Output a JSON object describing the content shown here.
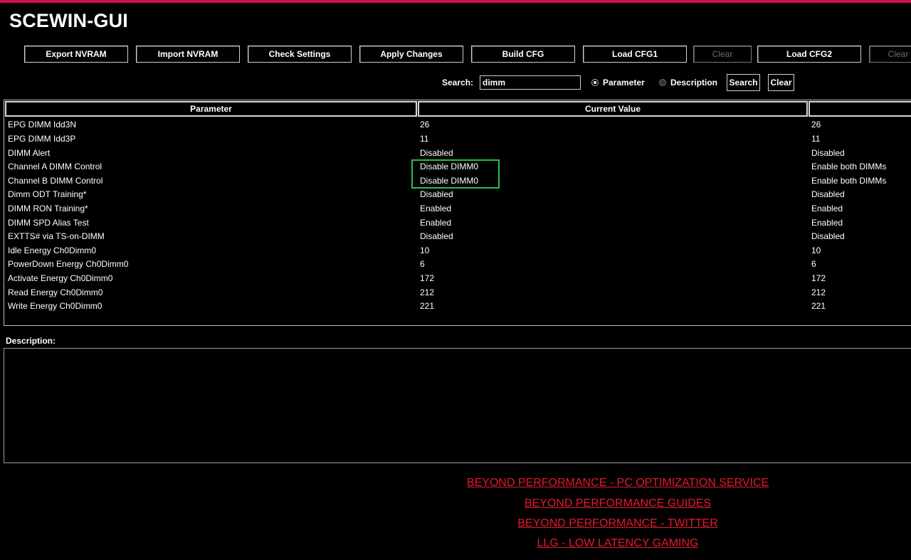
{
  "app": {
    "title": "SCEWIN-GUI"
  },
  "toolbar": {
    "export_nvram": "Export NVRAM",
    "import_nvram": "Import NVRAM",
    "check_settings": "Check Settings",
    "apply_changes": "Apply Changes",
    "build_cfg": "Build CFG",
    "load_cfg1": "Load CFG1",
    "clear1": "Clear",
    "load_cfg2": "Load CFG2",
    "clear2": "Clear"
  },
  "search": {
    "label": "Search:",
    "value": "dimm",
    "mode_parameter": "Parameter",
    "mode_description": "Description",
    "selected_mode": "Parameter",
    "search_button": "Search",
    "clear_button": "Clear"
  },
  "table": {
    "headers": [
      "Parameter",
      "Current Value",
      ""
    ],
    "rows": [
      [
        "EPG DIMM Idd3N",
        "26",
        "26"
      ],
      [
        "EPG DIMM Idd3P",
        "11",
        "11"
      ],
      [
        "DIMM Alert",
        "Disabled",
        "Disabled"
      ],
      [
        "Channel A DIMM Control",
        "Disable DIMM0",
        "Enable both DIMMs"
      ],
      [
        "Channel B DIMM Control",
        "Disable DIMM0",
        "Enable both DIMMs"
      ],
      [
        "Dimm ODT Training*",
        "Disabled",
        "Disabled"
      ],
      [
        "DIMM RON Training*",
        "Enabled",
        "Enabled"
      ],
      [
        "DIMM SPD Alias Test",
        "Enabled",
        "Enabled"
      ],
      [
        "EXTTS# via TS-on-DIMM",
        "Disabled",
        "Disabled"
      ],
      [
        "Idle Energy Ch0Dimm0",
        "10",
        "10"
      ],
      [
        "PowerDown Energy Ch0Dimm0",
        "6",
        "6"
      ],
      [
        "Activate Energy Ch0Dimm0",
        "172",
        "172"
      ],
      [
        "Read Energy Ch0Dimm0",
        "212",
        "212"
      ],
      [
        "Write Energy Ch0Dimm0",
        "221",
        "221"
      ]
    ]
  },
  "description": {
    "label": "Description:",
    "text": ""
  },
  "links": [
    "BEYOND PERFORMANCE - PC OPTIMIZATION SERVICE",
    "BEYOND PERFORMANCE GUIDES",
    "BEYOND PERFORMANCE - TWITTER",
    "LLG - LOW LATENCY GAMING"
  ],
  "colors": {
    "accent": "#d0104c",
    "link": "#e8192c",
    "highlight": "#23c24a",
    "background": "#000000"
  }
}
